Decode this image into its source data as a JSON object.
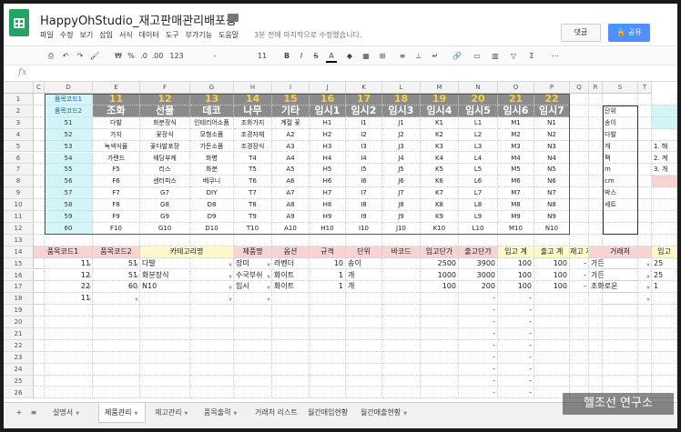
{
  "title": "HappyOhStudio_재고판매관리배포용",
  "menu": [
    "파일",
    "수정",
    "보기",
    "삽입",
    "서식",
    "데이터",
    "도구",
    "부가기능",
    "도움말"
  ],
  "last_edit": "3분 전에 마지막으로 수정했습니다.",
  "buttons": {
    "comment": "댓글",
    "share": "공유"
  },
  "toolbar": {
    "currency": "₩",
    "percent": "%",
    "decimal_dec": ".0",
    "decimal_inc": ".00",
    "format": "123",
    "font": "-",
    "size": "11",
    "bold": "B",
    "italic": "I",
    "strike": "S",
    "textcolor": "A",
    "sigma": "Σ"
  },
  "fx": "fx",
  "col_headers": [
    "C",
    "D",
    "E",
    "F",
    "G",
    "H",
    "I",
    "J",
    "K",
    "L",
    "M",
    "N",
    "O",
    "P",
    "Q",
    "R",
    "S",
    "T"
  ],
  "row_numbers": [
    "1",
    "2",
    "3",
    "4",
    "5",
    "6",
    "7",
    "8",
    "9",
    "10",
    "11",
    "12",
    "13",
    "14",
    "15",
    "16",
    "17",
    "18",
    "19",
    "20",
    "21",
    "22",
    "23",
    "24",
    "25",
    "26"
  ],
  "table1": {
    "r1_code1": "품목코드1",
    "r2_code2": "품목코드2",
    "numbers": [
      "11",
      "12",
      "13",
      "14",
      "15",
      "16",
      "17",
      "18",
      "19",
      "20",
      "21",
      "22"
    ],
    "categories": [
      "조화",
      "선물",
      "데코",
      "나무",
      "기타",
      "임시1",
      "임시2",
      "임시3",
      "임시4",
      "임시5",
      "임시6",
      "임시7"
    ],
    "rows": [
      [
        "51",
        "다발",
        "화분장식",
        "인테리어소품",
        "조화가지",
        "계절 꽃",
        "H1",
        "I1",
        "J1",
        "K1",
        "L1",
        "M1",
        "N1"
      ],
      [
        "52",
        "가지",
        "꽃장식",
        "모형소품",
        "조경자재",
        "A2",
        "H2",
        "I2",
        "J2",
        "K2",
        "L2",
        "M2",
        "N2"
      ],
      [
        "53",
        "녹색식물",
        "꽃다발포장",
        "가든소품",
        "조경장식",
        "A3",
        "H3",
        "I3",
        "J3",
        "K3",
        "L3",
        "M3",
        "N3"
      ],
      [
        "54",
        "가랜드",
        "웨딩부케",
        "화병",
        "T4",
        "A4",
        "H4",
        "I4",
        "J4",
        "K4",
        "L4",
        "M4",
        "N4"
      ],
      [
        "55",
        "F5",
        "리스",
        "화분",
        "T5",
        "A5",
        "H5",
        "I5",
        "J5",
        "K5",
        "L5",
        "M5",
        "N5"
      ],
      [
        "56",
        "F6",
        "센터피스",
        "베쿠니",
        "T6",
        "A6",
        "H6",
        "I6",
        "J6",
        "K6",
        "L6",
        "M6",
        "N6"
      ],
      [
        "57",
        "F7",
        "G7",
        "DIY",
        "T7",
        "A7",
        "H7",
        "I7",
        "J7",
        "K7",
        "L7",
        "M7",
        "N7"
      ],
      [
        "58",
        "F8",
        "G8",
        "D8",
        "T8",
        "A8",
        "H8",
        "I8",
        "J8",
        "K8",
        "L8",
        "M8",
        "N8"
      ],
      [
        "59",
        "F9",
        "G9",
        "D9",
        "T9",
        "A9",
        "H9",
        "I9",
        "J9",
        "K9",
        "L9",
        "M9",
        "N9"
      ],
      [
        "60",
        "F10",
        "G10",
        "D10",
        "T10",
        "A10",
        "H10",
        "I10",
        "J10",
        "K10",
        "L10",
        "M10",
        "N10"
      ]
    ]
  },
  "units": {
    "header": "단위",
    "items": [
      "송이",
      "다발",
      "개",
      "팩",
      "m",
      "cm",
      "박스",
      "세트"
    ]
  },
  "t_column": [
    "1. 해",
    "2. 계",
    "3. 개"
  ],
  "table2": {
    "headers": [
      "품목코드1",
      "품목코드2",
      "카테고리명",
      "제품명",
      "옵션",
      "규격",
      "단위",
      "바코드",
      "입고단가",
      "출고단가",
      "입고 계",
      "출고 계",
      "재고 계",
      "거래처",
      "입고"
    ],
    "rows": [
      [
        "11",
        "51",
        "다발",
        "장미",
        "라벤더",
        "10",
        "송이",
        "",
        "2500",
        "3900",
        "100",
        "100",
        "-",
        "가든",
        "25"
      ],
      [
        "12",
        "51",
        "화분장식",
        "수국부쉬",
        "화이트",
        "1",
        "개",
        "",
        "1000",
        "3000",
        "100",
        "100",
        "-",
        "가든",
        "25"
      ],
      [
        "22",
        "60",
        "N10",
        "임시",
        "화이트",
        "1",
        "개",
        "",
        "100",
        "200",
        "100",
        "100",
        "-",
        "조화로운",
        "1"
      ],
      [
        "11",
        "",
        "",
        "",
        "",
        "",
        "",
        "",
        "",
        "",
        "",
        "",
        "",
        "",
        ""
      ]
    ],
    "dash": "-"
  },
  "tabs": [
    "설명서",
    "제품관리",
    "재고관리",
    "품목출력",
    "거래처 리스트",
    "월간매입현황",
    "월간매출현황"
  ],
  "tab_controls": {
    "add": "+",
    "list": "≡"
  },
  "watermark": "헬조선 연구소"
}
